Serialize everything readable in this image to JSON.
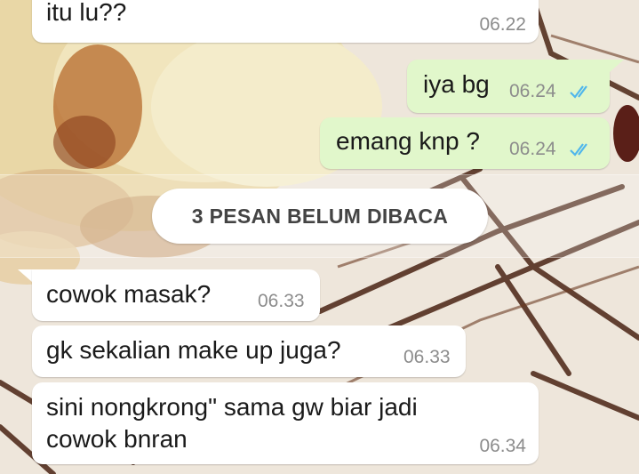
{
  "colors": {
    "incoming_bubble": "#ffffff",
    "outgoing_bubble": "#e1f7cb",
    "read_ticks": "#4fb6ec",
    "timestamp": "#8c8c8c"
  },
  "unread_banner": {
    "label": "3 PESAN BELUM DIBACA"
  },
  "messages": [
    {
      "direction": "incoming",
      "text": "itu lu??",
      "time": "06.22"
    },
    {
      "direction": "outgoing",
      "text": "iya bg",
      "time": "06.24",
      "status_icon": "double-check-read-icon"
    },
    {
      "direction": "outgoing",
      "text": "emang knp ?",
      "time": "06.24",
      "status_icon": "double-check-read-icon"
    },
    {
      "direction": "incoming",
      "text": "cowok masak?",
      "time": "06.33"
    },
    {
      "direction": "incoming",
      "text": "gk sekalian make up juga?",
      "time": "06.33"
    },
    {
      "direction": "incoming",
      "text_line1": "sini nongkrong\" sama gw biar jadi",
      "text_line2": "cowok bnran",
      "time": "06.34"
    }
  ]
}
